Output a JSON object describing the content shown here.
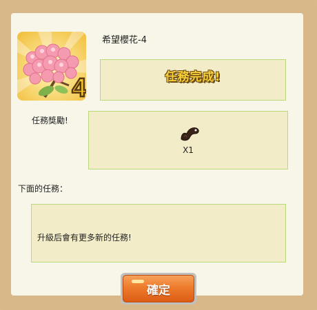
{
  "quest": {
    "title": "希望櫻花-4",
    "level_badge": "4",
    "icon": "cherry-blossom-icon"
  },
  "status": {
    "complete_text": "任務完成!"
  },
  "reward": {
    "label": "任務獎勵!",
    "item_icon": "dark-creature-item-icon",
    "quantity": "X1"
  },
  "next_quest": {
    "label": "下面的任務：",
    "text": "升級后會有更多新的任務!"
  },
  "buttons": {
    "confirm_label": "確定"
  },
  "colors": {
    "frame": "#d8b888",
    "panel": "#f8f6e9",
    "box_fill": "#f3ecc8",
    "box_border": "#b9d97a",
    "button_orange": "#ee7b2c",
    "complete_gold": "#f7cf3a"
  }
}
